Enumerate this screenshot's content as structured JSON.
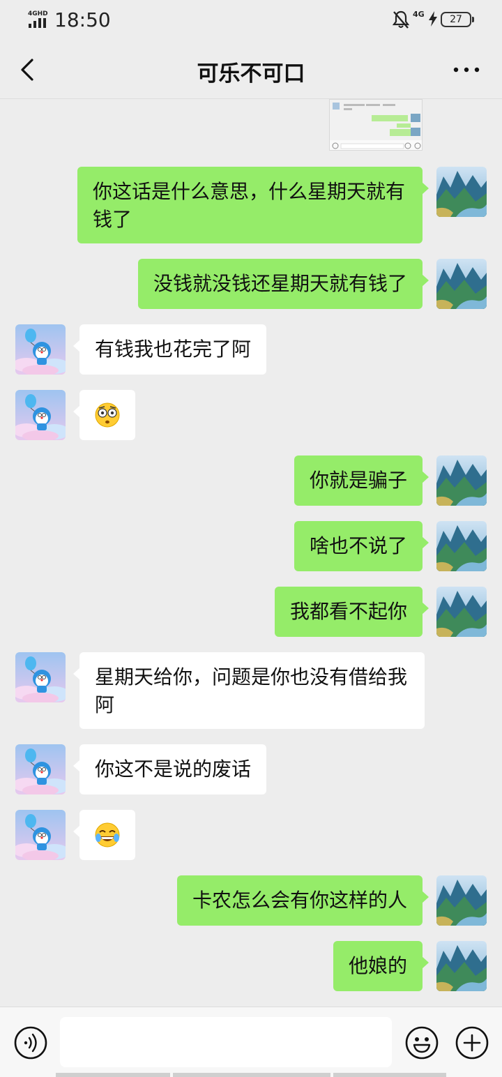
{
  "status_bar": {
    "network_label": "4GHD",
    "time": "18:50",
    "net_type": "4G",
    "battery": "27"
  },
  "header": {
    "title": "可乐不可口"
  },
  "messages": [
    {
      "side": "right",
      "text": "你这话是什么意思，什么星期天就有钱了"
    },
    {
      "side": "right",
      "text": "没钱就没钱还星期天就有钱了"
    },
    {
      "side": "left",
      "text": "有钱我也花完了阿"
    },
    {
      "side": "left",
      "emoji": "flushed-face"
    },
    {
      "side": "right",
      "text": "你就是骗子"
    },
    {
      "side": "right",
      "text": "啥也不说了"
    },
    {
      "side": "right",
      "text": "我都看不起你"
    },
    {
      "side": "left",
      "text": "星期天给你，问题是你也没有借给我阿"
    },
    {
      "side": "left",
      "text": "你这不是说的废话"
    },
    {
      "side": "left",
      "emoji": "tears-of-joy-face"
    },
    {
      "side": "right",
      "text": "卡农怎么会有你这样的人"
    },
    {
      "side": "right",
      "text": "他娘的"
    }
  ],
  "input": {
    "value": ""
  },
  "colors": {
    "background": "#ededed",
    "sent_bubble": "#95ec69",
    "received_bubble": "#ffffff"
  },
  "icons": [
    "signal-icon",
    "mute-bell-icon",
    "charging-icon",
    "back-chevron-icon",
    "more-icon",
    "voice-icon",
    "emoji-icon",
    "plus-icon"
  ]
}
